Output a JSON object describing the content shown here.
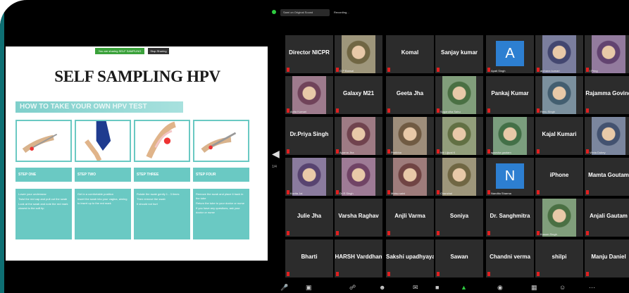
{
  "slide": {
    "share_text": "You are sharing SELF SAMPLING",
    "stop_share": "Stop Sharing",
    "title": "SELF SAMPLING HPV",
    "howto": "HOW TO TAKE YOUR OWN HPV TEST",
    "steps": [
      {
        "header": "STEP ONE",
        "lines": [
          "Lower your underwear",
          "Twist the red cap and pull out the swab",
          "Look at the swab and note the red mark closest to the soft tip"
        ]
      },
      {
        "header": "STEP TWO",
        "lines": [
          "Get in a comfortable position",
          "Insert the swab into your vagina, aiming to insert up to the red mark"
        ]
      },
      {
        "header": "STEP THREE",
        "lines": [
          "Rotate the swab gently 1 - 3 times",
          "Then remove the swab",
          "It should not hurt"
        ]
      },
      {
        "header": "STEP FOUR",
        "lines": [
          "Remove the swab and place it back in the tube",
          "Return the tube to your doctor or nurse",
          "If you have any questions, ask your doctor or nurse"
        ]
      }
    ]
  },
  "meeting": {
    "audio_chip": "Sami on Original Sound",
    "recording": "Recording...",
    "page_indicator": "1/4",
    "tiles": [
      {
        "name": "Director NICPR",
        "label": "",
        "type": "name"
      },
      {
        "name": "",
        "label": "O P Bansal",
        "type": "video"
      },
      {
        "name": "Komal",
        "label": "",
        "type": "name"
      },
      {
        "name": "Sanjay kumar",
        "label": "",
        "type": "name"
      },
      {
        "name": "A",
        "label": "Apati Singh",
        "type": "avatar"
      },
      {
        "name": "",
        "label": "archana kumari",
        "type": "video"
      },
      {
        "name": "",
        "label": "I Pring",
        "type": "video"
      },
      {
        "name": "",
        "label": "Anita Kumari",
        "type": "video"
      },
      {
        "name": "Galaxy M21",
        "label": "",
        "type": "name"
      },
      {
        "name": "Geeta Jha",
        "label": "",
        "type": "name"
      },
      {
        "name": "",
        "label": "Sugandha Sahu",
        "type": "video"
      },
      {
        "name": "Pankaj Kumar",
        "label": "",
        "type": "name"
      },
      {
        "name": "",
        "label": "Renu Singh",
        "type": "video"
      },
      {
        "name": "Rajamma Govind",
        "label": "",
        "type": "name"
      },
      {
        "name": "Dr.Priya Singh",
        "label": "",
        "type": "name"
      },
      {
        "name": "",
        "label": "Aparna Jha",
        "type": "video"
      },
      {
        "name": "",
        "label": "Pratibha",
        "type": "video"
      },
      {
        "name": "",
        "label": "Niti Ujjwal K",
        "type": "video"
      },
      {
        "name": "",
        "label": "sparsha gautam",
        "type": "video"
      },
      {
        "name": "Kajal Kumari",
        "label": "",
        "type": "name"
      },
      {
        "name": "",
        "label": "Vimla Dubey",
        "type": "video"
      },
      {
        "name": "",
        "label": "Kavita Jai",
        "type": "video"
      },
      {
        "name": "",
        "label": "Dr R Singh",
        "type": "video"
      },
      {
        "name": "",
        "label": "Motsu saini",
        "type": "video"
      },
      {
        "name": "",
        "label": "Chanchal",
        "type": "video"
      },
      {
        "name": "N",
        "label": "Nandita Sharma",
        "type": "avatar"
      },
      {
        "name": "iPhone",
        "label": "",
        "type": "name"
      },
      {
        "name": "Mamta Goutam",
        "label": "",
        "type": "name"
      },
      {
        "name": "Julie Jha",
        "label": "",
        "type": "name"
      },
      {
        "name": "Varsha Raghav",
        "label": "",
        "type": "name"
      },
      {
        "name": "Anjli Varma",
        "label": "",
        "type": "name"
      },
      {
        "name": "Soniya",
        "label": "",
        "type": "name"
      },
      {
        "name": "Dr. Sanghmitra",
        "label": "",
        "type": "name"
      },
      {
        "name": "",
        "label": "Kusum Singh",
        "type": "video"
      },
      {
        "name": "Anjali Gautam",
        "label": "",
        "type": "name"
      },
      {
        "name": "Bharti",
        "label": "",
        "type": "name"
      },
      {
        "name": "HARSH Varddhan",
        "label": "",
        "type": "name"
      },
      {
        "name": "Sakshi upadhyaya",
        "label": "",
        "type": "name"
      },
      {
        "name": "Sawan",
        "label": "",
        "type": "name"
      },
      {
        "name": "Chandni verma",
        "label": "",
        "type": "name"
      },
      {
        "name": "shilpi",
        "label": "",
        "type": "name"
      },
      {
        "name": "Manju Daniel",
        "label": "",
        "type": "name"
      }
    ]
  },
  "colors": {
    "teal": "#6ac9c3",
    "avatar_blue": "#2d7fd1",
    "mute_red": "#e02020",
    "tile_bg": "#2c2c2c"
  }
}
